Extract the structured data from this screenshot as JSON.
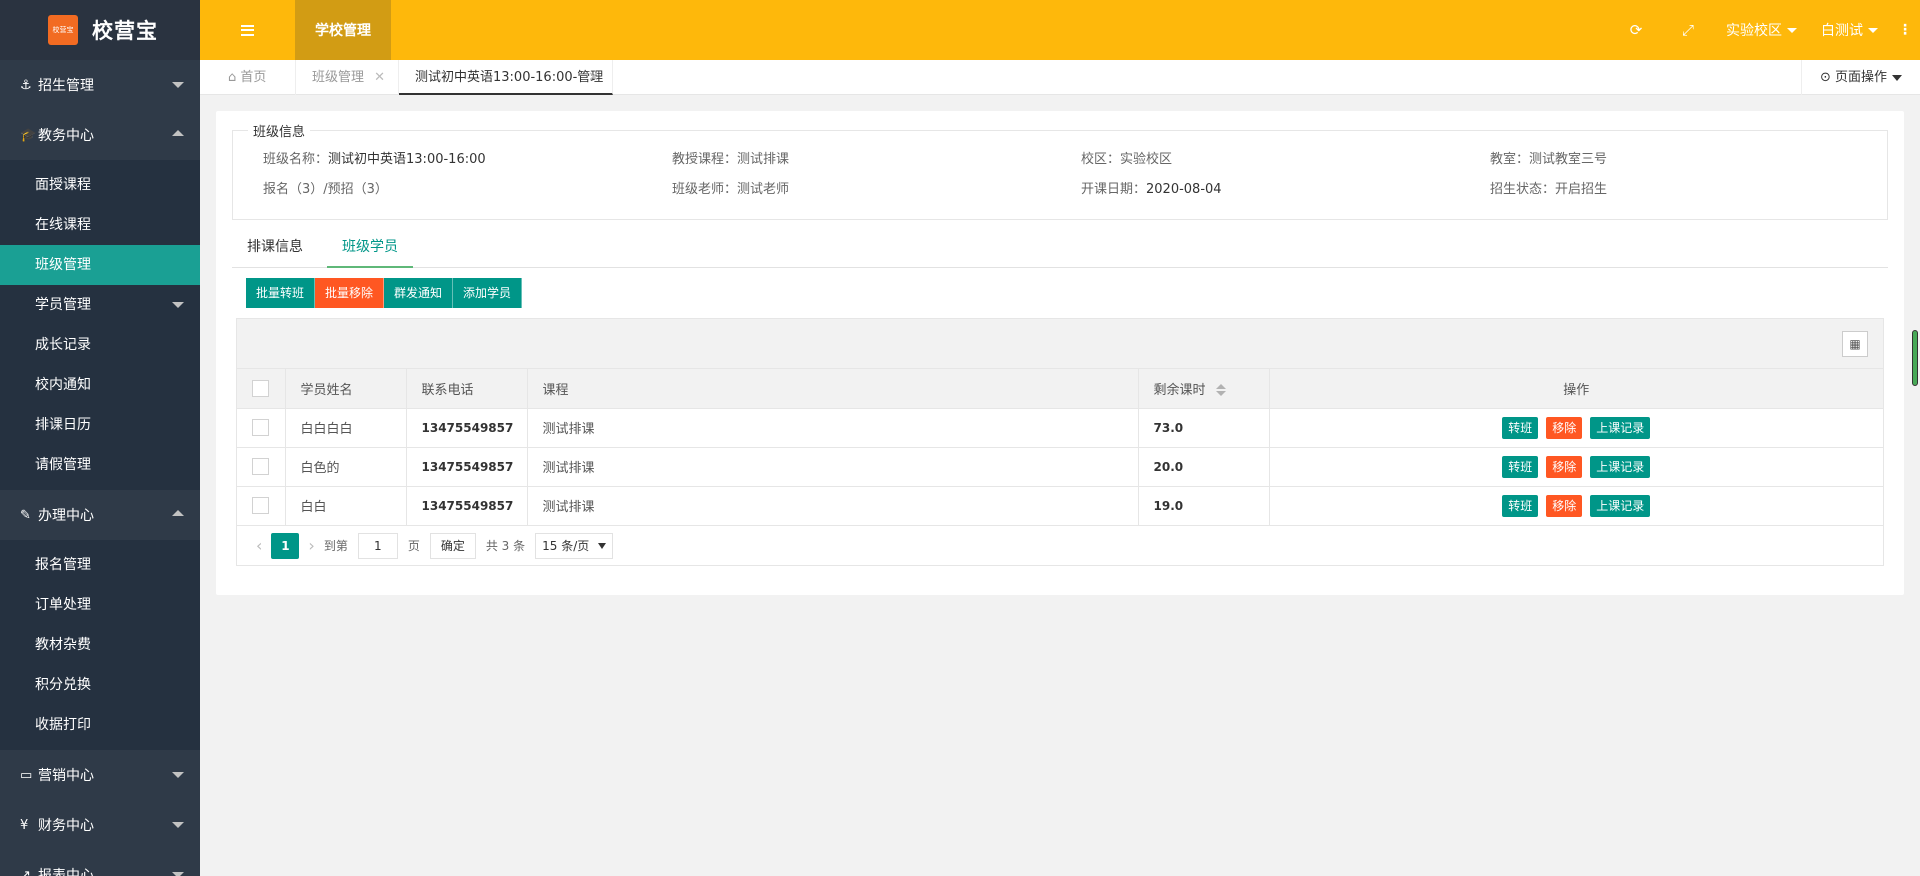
{
  "app": {
    "logo_text": "校营宝",
    "logo_mark_text": "校营宝"
  },
  "sidebar": {
    "groups": [
      {
        "icon": "⚓",
        "label": "招生管理",
        "open": false
      },
      {
        "icon": "🎓",
        "label": "教务中心",
        "open": true
      },
      {
        "icon": "✎",
        "label": "办理中心",
        "open": true
      },
      {
        "icon": "▭",
        "label": "营销中心",
        "open": false
      },
      {
        "icon": "¥",
        "label": "财务中心",
        "open": false
      },
      {
        "icon": "↗",
        "label": "报表中心",
        "open": false
      }
    ],
    "edu_items": [
      "面授课程",
      "在线课程",
      "班级管理",
      "学员管理",
      "成长记录",
      "校内通知",
      "排课日历",
      "请假管理"
    ],
    "handle_items": [
      "报名管理",
      "订单处理",
      "教材杂费",
      "积分兑换",
      "收据打印"
    ]
  },
  "header": {
    "active_tab": "学校管理",
    "campus": "实验校区",
    "user": "白测试"
  },
  "page_tabs": {
    "home": "首页",
    "tab2": "班级管理",
    "tab3": "测试初中英语13:00-16:00-管理",
    "page_op": "页面操作"
  },
  "class_info": {
    "legend": "班级信息",
    "name_label": "班级名称：",
    "name": "测试初中英语13:00-16:00",
    "course_label": "教授课程：",
    "course": "测试排课",
    "campus_label": "校区：",
    "campus": "实验校区",
    "room_label": "教室：",
    "room": "测试教室三号",
    "enroll_text": "报名（3）/预招（3）",
    "teacher_label": "班级老师：",
    "teacher": "测试老师",
    "start_label": "开课日期：",
    "start": "2020-08-04",
    "status_label": "招生状态：",
    "status": "开启招生"
  },
  "content_tabs": {
    "schedule": "排课信息",
    "students": "班级学员"
  },
  "actions": {
    "batch_transfer": "批量转班",
    "batch_remove": "批量移除",
    "group_notify": "群发通知",
    "add_student": "添加学员"
  },
  "table": {
    "headers": {
      "name": "学员姓名",
      "phone": "联系电话",
      "course": "课程",
      "hours": "剩余课时",
      "ops": "操作"
    },
    "rows": [
      {
        "name": "白白白白",
        "phone": "13475549857",
        "course": "测试排课",
        "hours": "73.0"
      },
      {
        "name": "白色的",
        "phone": "13475549857",
        "course": "测试排课",
        "hours": "20.0"
      },
      {
        "name": "白白",
        "phone": "13475549857",
        "course": "测试排课",
        "hours": "19.0"
      }
    ],
    "row_ops": {
      "transfer": "转班",
      "remove": "移除",
      "record": "上课记录"
    }
  },
  "pager": {
    "current": "1",
    "goto_label": "到第",
    "page_input": "1",
    "page_unit": "页",
    "confirm": "确定",
    "total": "共 3 条",
    "page_size": "15 条/页"
  },
  "colors": {
    "header": "#feb80b",
    "sidebar": "#2f3a48",
    "accent": "#009688",
    "danger": "#ff5722"
  }
}
